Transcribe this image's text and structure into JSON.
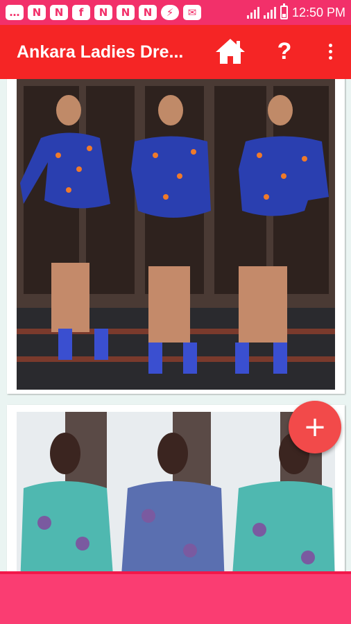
{
  "status_bar": {
    "time": "12:50 PM",
    "notifications": [
      {
        "icon": "message-icon",
        "glyph": "…"
      },
      {
        "icon": "n-app-icon",
        "glyph": "N"
      },
      {
        "icon": "n-app-icon",
        "glyph": "N"
      },
      {
        "icon": "facebook-icon",
        "glyph": "f"
      },
      {
        "icon": "n-app-icon",
        "glyph": "N"
      },
      {
        "icon": "n-app-icon",
        "glyph": "N"
      },
      {
        "icon": "n-app-icon",
        "glyph": "N"
      },
      {
        "icon": "messenger-icon",
        "glyph": "⚡"
      },
      {
        "icon": "mail-icon",
        "glyph": "✉"
      }
    ]
  },
  "app_bar": {
    "title": "Ankara Ladies Dre...",
    "help_label": "?"
  },
  "colors": {
    "status_bar": "#f2306a",
    "app_bar": "#f52525",
    "fab": "#f24a4a",
    "bottom_bar": "#fa3d72"
  },
  "fab": {
    "label": "+"
  }
}
